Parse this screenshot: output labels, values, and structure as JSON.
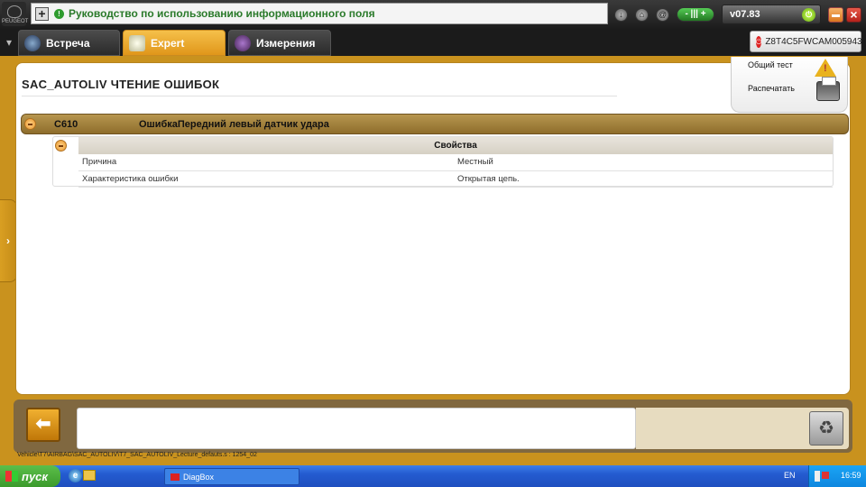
{
  "header": {
    "logo_text": "PEUGEOT",
    "message": "Руководство по использованию информационного поля",
    "version": "v07.83"
  },
  "tabs": [
    {
      "label": "Встреча"
    },
    {
      "label": "Expert"
    },
    {
      "label": "Измерения"
    }
  ],
  "vin": "Z8T4C5FWCAM005943",
  "page": {
    "title": "SAC_AUTOLIV  ЧТЕНИЕ ОШИБОК"
  },
  "actions": {
    "general_test": "Общий тест",
    "print": "Распечатать"
  },
  "fault": {
    "code": "C610",
    "description": "ОшибкаПередний левый датчик удара",
    "properties_header": "Свойства",
    "properties": [
      {
        "name": "Причина",
        "value": "Местный"
      },
      {
        "name": "Характеристика ошибки",
        "value": "Открытая цепь."
      }
    ]
  },
  "status_path": "Vehicle\\T7\\AIRBAG\\SAC_AUTOLIV\\T7_SAC_AUTOLIV_Lecture_defauts.s : 1254_02",
  "taskbar": {
    "start": "пуск",
    "task": "DiagBox",
    "lang": "EN",
    "time": "16:59"
  },
  "colors": {
    "accent": "#c9921e",
    "tab_active": "#e9a52a",
    "fault_header": "#a3803e"
  }
}
